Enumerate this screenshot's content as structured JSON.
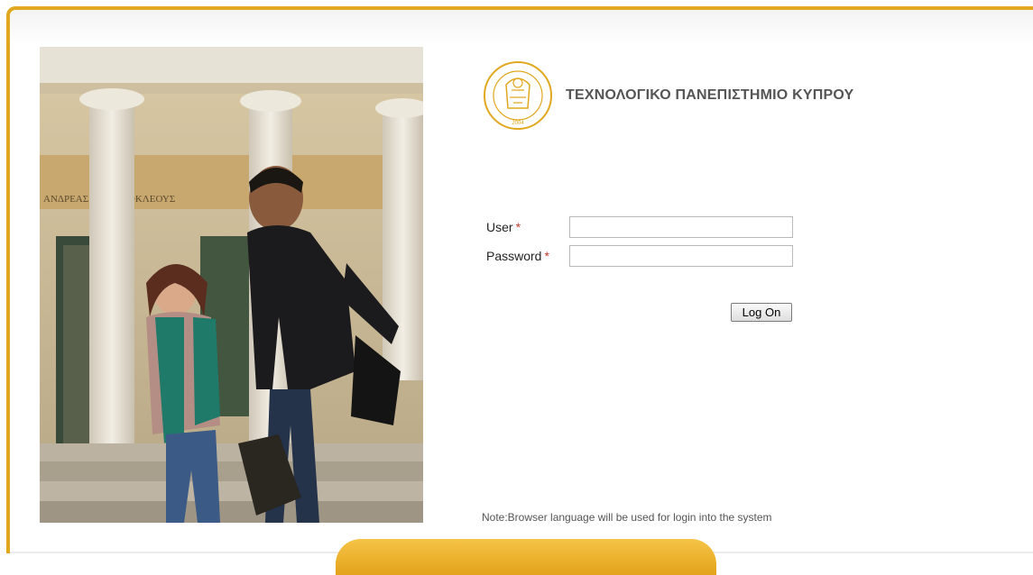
{
  "header": {
    "university_name": "ΤΕΧΝΟΛΟΓΙΚΟ ΠΑΝΕΠΙΣΤΗΜΙΟ ΚΥΠΡΟΥ",
    "seal_text": "ΤΕΧΝΟΛΟΓΙΚΟ ΠΑΝΕΠΙΣΤΗΜΙΟ ΚΥΠΡΟΥ",
    "seal_year": "2004"
  },
  "hero": {
    "building_inscription": "ΑΝΔΡΕΑΣ ΘΕΜΙΣΤΟΚΛΕΟΥΣ"
  },
  "form": {
    "user_label": "User",
    "password_label": "Password",
    "required_marker": "*",
    "user_value": "",
    "password_value": "",
    "logon_label": "Log On"
  },
  "footer": {
    "note": "Note:Browser language will be used for login into the system"
  },
  "colors": {
    "accent": "#e0a81e",
    "required": "#c0392b",
    "title": "#555555"
  }
}
